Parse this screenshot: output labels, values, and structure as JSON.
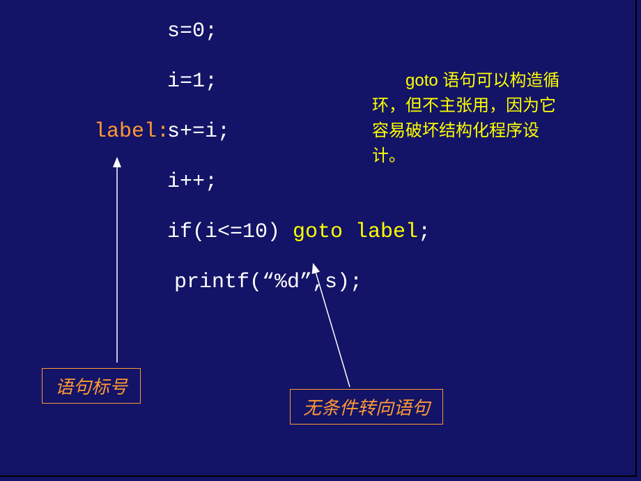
{
  "code": {
    "line1": "s=0;",
    "line2": "i=1;",
    "line3_label": "label:",
    "line3_code": "s+=i;",
    "line4": "i++;",
    "line5_pre": "if(i<=10) ",
    "line5_goto": "goto label",
    "line5_post": ";",
    "line6": "printf(“%d”,s);"
  },
  "note": "goto 语句可以构造循环，但不主张用，因为它容易破坏结构化程序设计。",
  "annotations": {
    "left": "语句标号",
    "right": "无条件转向语句"
  }
}
